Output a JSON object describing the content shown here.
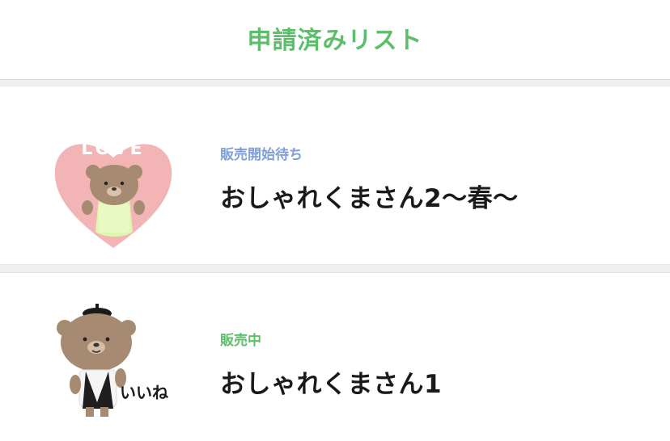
{
  "header": {
    "title": "申請済みリスト",
    "title_color": "#5bbf6a"
  },
  "items": [
    {
      "status": "販売開始待ち",
      "status_color": "#7f9fd6",
      "title": "おしゃれくまさん2〜春〜",
      "thumbnail_icon": "bear-love-heart-sticker",
      "thumbnail_text": "LOVE"
    },
    {
      "status": "販売中",
      "status_color": "#5bbf6a",
      "title": "おしゃれくまさん1",
      "thumbnail_icon": "bear-beret-iine-sticker",
      "thumbnail_text": "いいね"
    }
  ]
}
